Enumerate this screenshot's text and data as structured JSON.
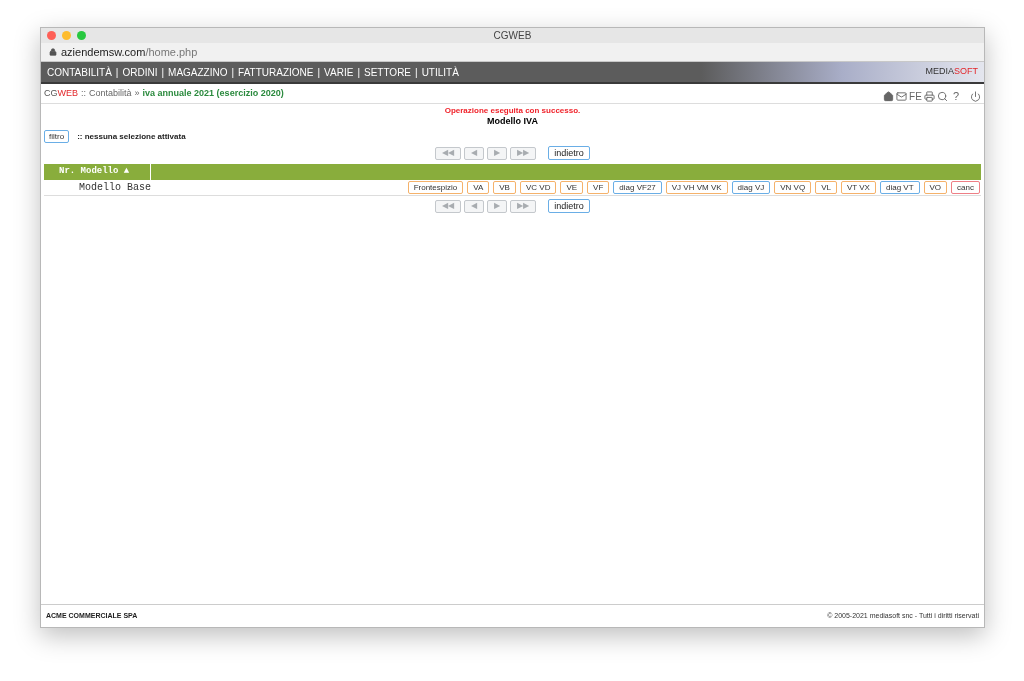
{
  "window": {
    "title": "CGWEB",
    "url_domain": "aziendemsw.com",
    "url_path": "/home.php"
  },
  "menu": {
    "items": [
      "CONTABILITÀ",
      "ORDINI",
      "MAGAZZINO",
      "FATTURAZIONE",
      "VARIE",
      "SETTORE",
      "UTILITÀ"
    ],
    "separator": "|",
    "brand_a": "MEDIA",
    "brand_b": "SOFT"
  },
  "breadcrumb": {
    "logo_a": "CG",
    "logo_b": "WEB",
    "sep1": "::",
    "section": "Contabilità",
    "sep2": "»",
    "current": "iva annuale 2021 (esercizio 2020)"
  },
  "toolbar": {
    "fe": "FE",
    "help": "?"
  },
  "message": "Operazione eseguita con successo.",
  "heading": "Modello IVA",
  "filter": {
    "button": "filtro",
    "status": ":: nessuna selezione attivata"
  },
  "pagers": [
    {
      "buttons": [
        {
          "label": "◀◀",
          "disabled": true
        },
        {
          "label": "◀",
          "disabled": true
        },
        {
          "label": "▶",
          "disabled": true
        },
        {
          "label": "▶▶",
          "disabled": true
        }
      ],
      "back": "indietro"
    },
    {
      "buttons": [
        {
          "label": "◀◀",
          "disabled": true
        },
        {
          "label": "◀",
          "disabled": true
        },
        {
          "label": "▶",
          "disabled": true
        },
        {
          "label": "▶▶",
          "disabled": true
        }
      ],
      "back": "indietro"
    }
  ],
  "table": {
    "column": "Nr. Modello ▲",
    "rows": [
      {
        "name": "Modello Base",
        "actions": [
          {
            "label": "Frontespizio",
            "color": "#f5b26b"
          },
          {
            "label": "VA",
            "color": "#f5b26b"
          },
          {
            "label": "VB",
            "color": "#f5b26b"
          },
          {
            "label": "VC VD",
            "color": "#f5b26b"
          },
          {
            "label": "VE",
            "color": "#f5b26b"
          },
          {
            "label": "VF",
            "color": "#f5b26b"
          },
          {
            "label": "diag VF27",
            "color": "#6aaee6"
          },
          {
            "label": "VJ VH VM VK",
            "color": "#f5b26b"
          },
          {
            "label": "diag VJ",
            "color": "#6aaee6"
          },
          {
            "label": "VN VQ",
            "color": "#f5b26b"
          },
          {
            "label": "VL",
            "color": "#f5b26b"
          },
          {
            "label": "VT VX",
            "color": "#f5b26b"
          },
          {
            "label": "diag VT",
            "color": "#6aaee6"
          },
          {
            "label": "VO",
            "color": "#f5b26b"
          },
          {
            "label": "canc",
            "color": "#ee7f86"
          }
        ]
      }
    ]
  },
  "footer": {
    "company": "ACME COMMERCIALE SPA",
    "copyright": "© 2005-2021 mediasoft snc - Tutti i diritti riservati"
  }
}
